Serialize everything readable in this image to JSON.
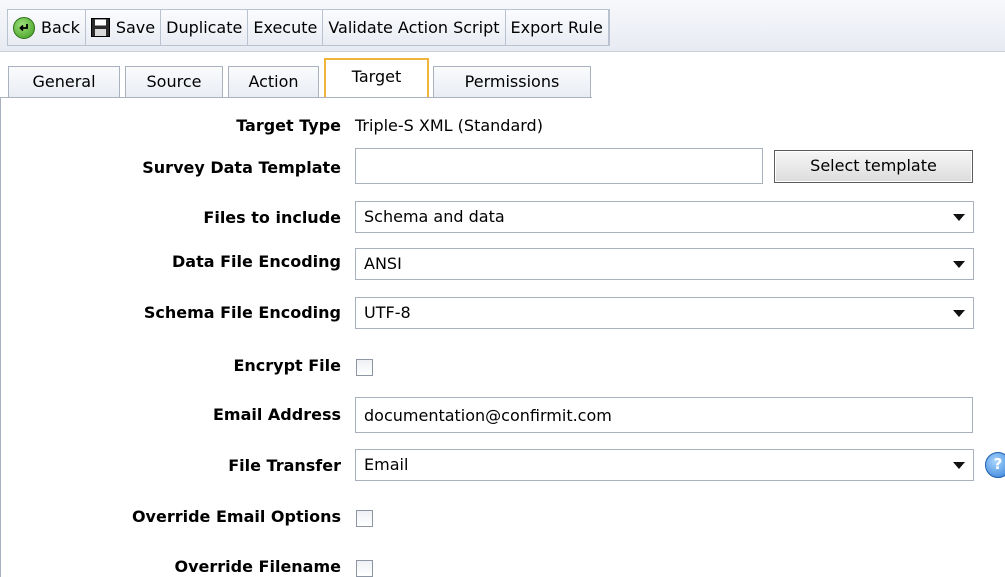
{
  "toolbar": {
    "back": "Back",
    "save": "Save",
    "duplicate": "Duplicate",
    "execute": "Execute",
    "validate": "Validate Action Script",
    "export": "Export Rule"
  },
  "tabs": [
    "General",
    "Source",
    "Action",
    "Target",
    "Permissions"
  ],
  "active_tab": "Target",
  "form": {
    "target_type_label": "Target Type",
    "target_type_value": "Triple-S XML (Standard)",
    "survey_template_label": "Survey Data Template",
    "survey_template_value": "",
    "select_template_button": "Select template",
    "files_label": "Files to include",
    "files_value": "Schema and data",
    "data_encoding_label": "Data File Encoding",
    "data_encoding_value": "ANSI",
    "schema_encoding_label": "Schema File Encoding",
    "schema_encoding_value": "UTF-8",
    "encrypt_label": "Encrypt File",
    "encrypt_checked": false,
    "email_label": "Email Address",
    "email_value": "documentation@confirmit.com",
    "file_transfer_label": "File Transfer",
    "file_transfer_value": "Email",
    "override_email_label": "Override Email Options",
    "override_email_checked": false,
    "override_filename_label": "Override Filename",
    "override_filename_checked": false
  },
  "icons": {
    "back": "back-arrow-icon",
    "save": "floppy-disk-icon",
    "help": "help-icon"
  },
  "colors": {
    "active_tab_border": "#f0b43a",
    "back_icon": "#3c9a1e",
    "help_icon": "#2e7bd6"
  }
}
